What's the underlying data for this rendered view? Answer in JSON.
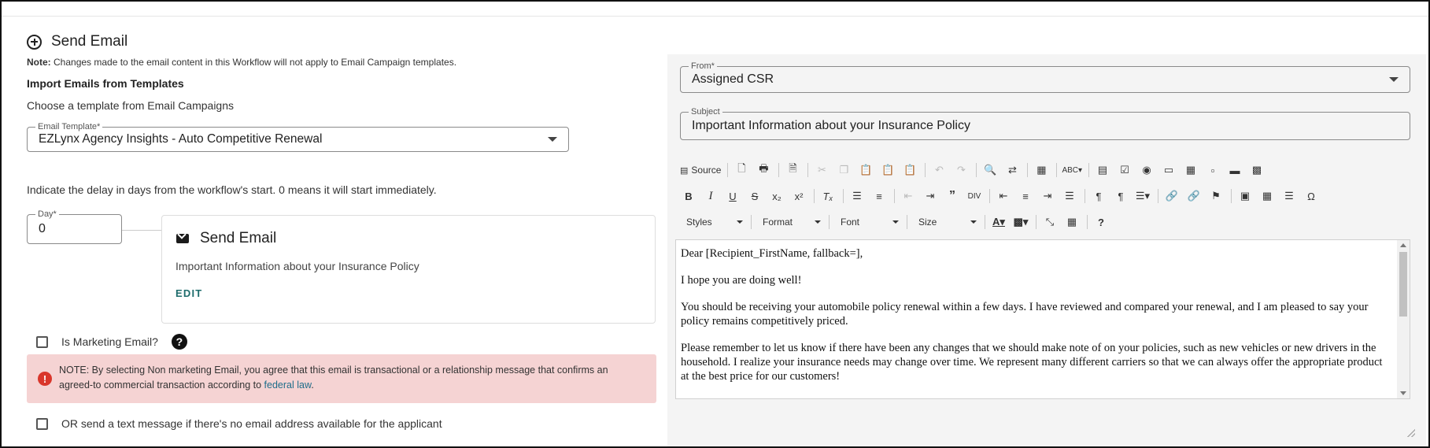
{
  "header": {
    "title": "Send Email"
  },
  "note": {
    "prefix": "Note:",
    "text": " Changes made to the email content in this Workflow will not apply to Email Campaign templates."
  },
  "import": {
    "title": "Import Emails from Templates",
    "choose": "Choose a template from Email Campaigns"
  },
  "template_field": {
    "label": "Email Template*",
    "value": "EZLynx Agency Insights - Auto Competitive Renewal"
  },
  "delay": {
    "text": "Indicate the delay in days from the workflow's start. 0 means it will start immediately.",
    "label": "Day*",
    "value": "0"
  },
  "card": {
    "title": "Send Email",
    "subtitle": "Important Information about your Insurance Policy",
    "edit_label": "EDIT"
  },
  "marketing": {
    "label": "Is Marketing Email?",
    "help": "?"
  },
  "alert": {
    "text": "NOTE: By selecting Non marketing Email, you agree that this email is transactional or a relationship message that confirms an agreed-to commercial transaction according to ",
    "link": "federal law",
    "suffix": "."
  },
  "sms": {
    "label": "OR send a text message if there's no email address available for the applicant"
  },
  "from_field": {
    "label": "From*",
    "value": "Assigned CSR"
  },
  "subject_field": {
    "label": "Subject",
    "value": "Important Information about your Insurance Policy"
  },
  "toolbar": {
    "source_label": "Source",
    "styles_label": "Styles",
    "format_label": "Format",
    "font_label": "Font",
    "size_label": "Size"
  },
  "editor": {
    "p1": "Dear [Recipient_FirstName, fallback=],",
    "p2": "I hope you are doing well!",
    "p3": "You should be receiving your automobile policy renewal within a few days. I have reviewed and compared your renewal, and I am pleased to say your policy remains competitively priced.",
    "p4": "Please remember to let us know if there have been any changes that we should make note of on your policies, such as new vehicles or new drivers in the household. I realize your insurance needs may change over time. We represent many different carriers so that we can always offer the appropriate product at the best price for our customers!"
  }
}
